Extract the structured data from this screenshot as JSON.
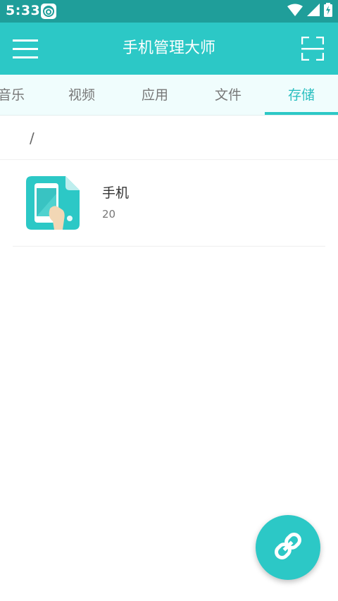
{
  "status_bar": {
    "time": "5:33",
    "app_icon": "eye-logo-icon",
    "icons": [
      "wifi-icon",
      "signal-icon",
      "battery-charging-icon"
    ]
  },
  "app_bar": {
    "title": "手机管理大师",
    "menu_icon": "menu-icon",
    "scan_icon": "scan-icon"
  },
  "tabs": [
    {
      "label": "音乐",
      "active": false
    },
    {
      "label": "视频",
      "active": false
    },
    {
      "label": "应用",
      "active": false
    },
    {
      "label": "文件",
      "active": false
    },
    {
      "label": "存储",
      "active": true
    }
  ],
  "breadcrumb": {
    "path": "/"
  },
  "items": [
    {
      "title": "手机",
      "subtitle": "20",
      "icon": "phone-storage-icon"
    }
  ],
  "fab": {
    "icon": "link-icon"
  },
  "colors": {
    "primary": "#2cc8c6",
    "status_bar": "#1f9e9a",
    "tab_bg": "#f0fdfd",
    "active_tab": "#2bbfc0"
  }
}
